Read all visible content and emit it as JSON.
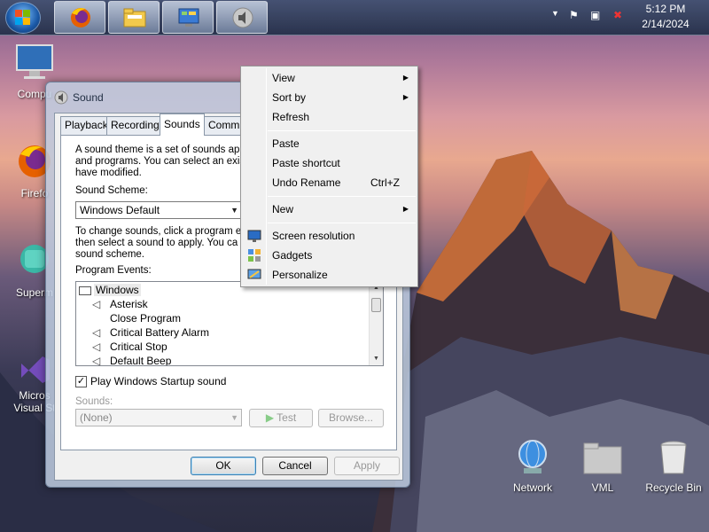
{
  "taskbar": {
    "start_label": "Start",
    "pinned": [
      "firefox-icon",
      "explorer-icon",
      "control-panel-icon",
      "speaker-icon"
    ],
    "clock_time": "5:12 PM",
    "clock_date": "2/14/2024"
  },
  "desktop": {
    "icons": [
      {
        "label": "Compu"
      },
      {
        "label": "Firefo"
      },
      {
        "label": "Superm"
      },
      {
        "label": "Micros"
      },
      {
        "label": "Visual St"
      },
      {
        "label": "Network"
      },
      {
        "label": "VML"
      },
      {
        "label": "Recycle Bin"
      }
    ]
  },
  "sound_dialog": {
    "title": "Sound",
    "tabs": [
      "Playback",
      "Recording",
      "Sounds",
      "Commun"
    ],
    "active_tab": "Sounds",
    "intro_lines": [
      "A sound theme is a set of sounds ap",
      "and programs.  You can select an exis",
      "have modified."
    ],
    "scheme_label": "Sound Scheme:",
    "scheme_value": "Windows Default",
    "instr_lines": [
      "To change sounds, click a program e",
      "then select a sound to apply.  You ca",
      "sound scheme."
    ],
    "events_label": "Program Events:",
    "events": [
      {
        "label": "Windows"
      },
      {
        "label": "Asterisk"
      },
      {
        "label": "Close Program"
      },
      {
        "label": "Critical Battery Alarm"
      },
      {
        "label": "Critical Stop"
      },
      {
        "label": "Default Beep"
      }
    ],
    "startup_checkbox_label": "Play Windows Startup sound",
    "startup_checked": true,
    "sounds_label": "Sounds:",
    "sounds_value": "(None)",
    "test_label": "Test",
    "browse_label": "Browse...",
    "ok_label": "OK",
    "cancel_label": "Cancel",
    "apply_label": "Apply"
  },
  "context_menu": {
    "items": [
      {
        "label": "View"
      },
      {
        "label": "Sort by"
      },
      {
        "label": "Refresh"
      },
      {
        "label": "Paste"
      },
      {
        "label": "Paste shortcut"
      },
      {
        "label": "Undo Rename",
        "accel": "Ctrl+Z"
      },
      {
        "label": "New"
      },
      {
        "label": "Screen resolution"
      },
      {
        "label": "Gadgets"
      },
      {
        "label": "Personalize"
      }
    ]
  }
}
